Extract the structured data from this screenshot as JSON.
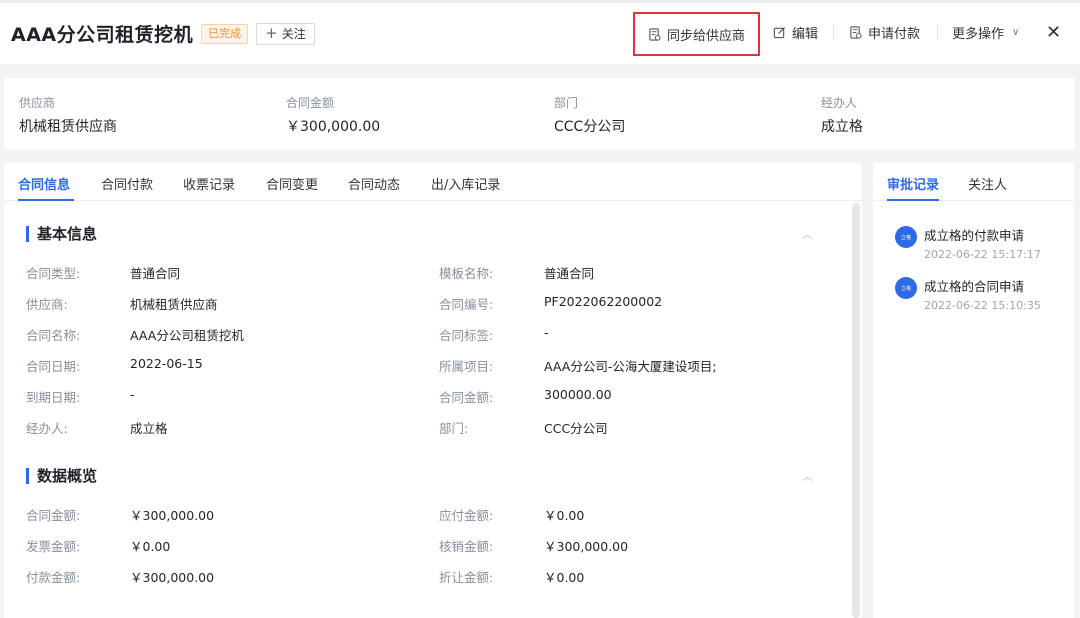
{
  "header": {
    "title": "AAA分公司租赁挖机",
    "status_badge": "已完成",
    "follow_label": "关注",
    "actions": {
      "sync_label": "同步给供应商",
      "edit_label": "编辑",
      "pay_request_label": "申请付款",
      "more_label": "更多操作"
    },
    "close_glyph": "✕"
  },
  "summary": {
    "items": [
      {
        "label": "供应商",
        "value": "机械租赁供应商"
      },
      {
        "label": "合同金额",
        "value": "￥300,000.00"
      },
      {
        "label": "部门",
        "value": "CCC分公司"
      },
      {
        "label": "经办人",
        "value": "成立格"
      }
    ]
  },
  "tabs": [
    {
      "label": "合同信息"
    },
    {
      "label": "合同付款"
    },
    {
      "label": "收票记录"
    },
    {
      "label": "合同变更"
    },
    {
      "label": "合同动态"
    },
    {
      "label": "出/入库记录"
    }
  ],
  "basic_info": {
    "title": "基本信息",
    "left": [
      {
        "label": "合同类型:",
        "value": "普通合同"
      },
      {
        "label": "供应商:",
        "value": "机械租赁供应商"
      },
      {
        "label": "合同名称:",
        "value": "AAA分公司租赁挖机"
      },
      {
        "label": "合同日期:",
        "value": "2022-06-15"
      },
      {
        "label": "到期日期:",
        "value": "-"
      },
      {
        "label": "经办人:",
        "value": "成立格"
      }
    ],
    "right": [
      {
        "label": "模板名称:",
        "value": "普通合同"
      },
      {
        "label": "合同编号:",
        "value": "PF2022062200002"
      },
      {
        "label": "合同标签:",
        "value": "-"
      },
      {
        "label": "所属项目:",
        "value": "AAA分公司-公海大厦建设项目;"
      },
      {
        "label": "合同金额:",
        "value": "300000.00"
      },
      {
        "label": "部门:",
        "value": "CCC分公司"
      }
    ]
  },
  "data_overview": {
    "title": "数据概览",
    "left": [
      {
        "label": "合同金额:",
        "value": "￥300,000.00"
      },
      {
        "label": "发票金额:",
        "value": "￥0.00"
      },
      {
        "label": "付款金额:",
        "value": "￥300,000.00"
      }
    ],
    "right": [
      {
        "label": "应付金额:",
        "value": "￥0.00"
      },
      {
        "label": "核销金额:",
        "value": "￥300,000.00"
      },
      {
        "label": "折让金额:",
        "value": "￥0.00"
      }
    ]
  },
  "side": {
    "tabs": [
      {
        "label": "审批记录"
      },
      {
        "label": "关注人"
      }
    ],
    "records": [
      {
        "avatar_text": "立格",
        "title": "成立格的付款申请",
        "time": "2022-06-22 15:17:17"
      },
      {
        "avatar_text": "立格",
        "title": "成立格的合同申请",
        "time": "2022-06-22 15:10:35"
      }
    ]
  },
  "colors": {
    "accent": "#2d6ae8",
    "highlight_box": "#e0343a",
    "badge": "#e8913a"
  }
}
